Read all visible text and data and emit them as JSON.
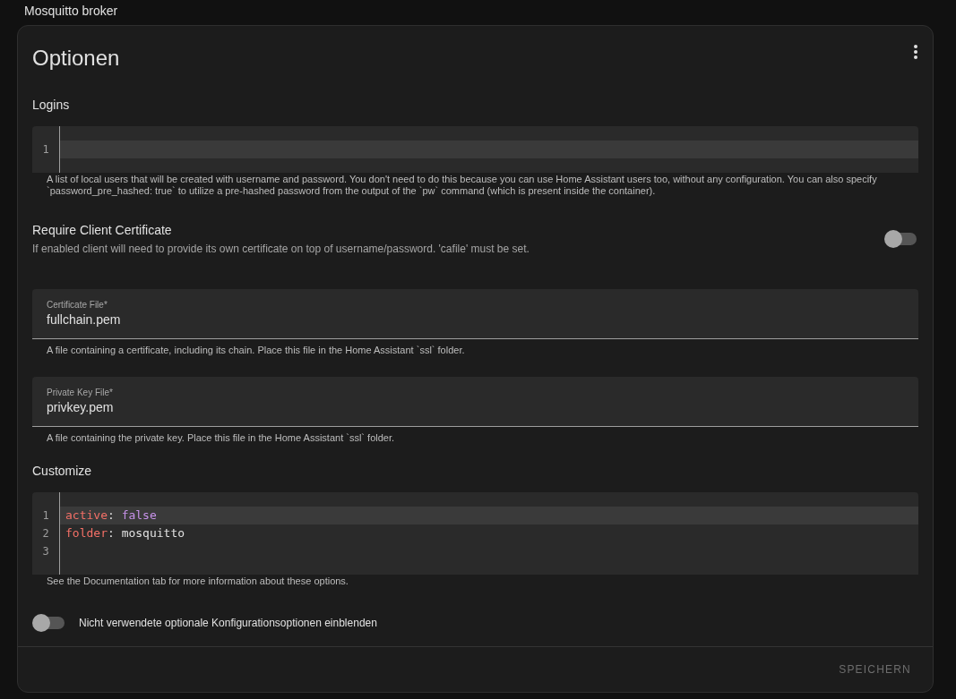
{
  "page_title": "Mosquitto broker",
  "card": {
    "title": "Optionen",
    "sections": [
      {
        "kind": "code",
        "label": "Logins",
        "lines": [
          {
            "number": "1",
            "active": true
          }
        ],
        "helper": "A list of local users that will be created with username and password. You don't need to do this because you can use Home Assistant users too, without any configuration. You can also specify `password_pre_hashed: true` to utilize a pre-hashed password from the output of the `pw` command (which is present inside the container)."
      },
      {
        "kind": "switch",
        "label": "Require Client Certificate",
        "description": "If enabled client will need to provide its own certificate on top of username/password. 'cafile' must be set.",
        "on": false
      },
      {
        "kind": "text",
        "label": "Certificate File*",
        "value": "fullchain.pem",
        "helper": "A file containing a certificate, including its chain. Place this file in the Home Assistant `ssl` folder."
      },
      {
        "kind": "text",
        "label": "Private Key File*",
        "value": "privkey.pem",
        "helper": "A file containing the private key. Place this file in the Home Assistant `ssl` folder."
      },
      {
        "kind": "code",
        "label": "Customize",
        "lines": [
          {
            "number": "1",
            "active": true,
            "tokens": [
              {
                "kind": "key",
                "text": "active"
              },
              {
                "kind": "punct",
                "text": ": "
              },
              {
                "kind": "bool",
                "text": "false"
              }
            ]
          },
          {
            "number": "2",
            "active": false,
            "tokens": [
              {
                "kind": "key",
                "text": "folder"
              },
              {
                "kind": "punct",
                "text": ": "
              },
              {
                "kind": "string",
                "text": "mosquitto"
              }
            ]
          },
          {
            "number": "3",
            "active": false
          }
        ],
        "helper": "See the Documentation tab for more information about these options."
      }
    ],
    "show_unused": {
      "label": "Nicht verwendete optionale Konfigurationsoptionen einblenden",
      "on": false
    },
    "save_button": {
      "label": "SPEICHERN",
      "disabled": true
    }
  }
}
